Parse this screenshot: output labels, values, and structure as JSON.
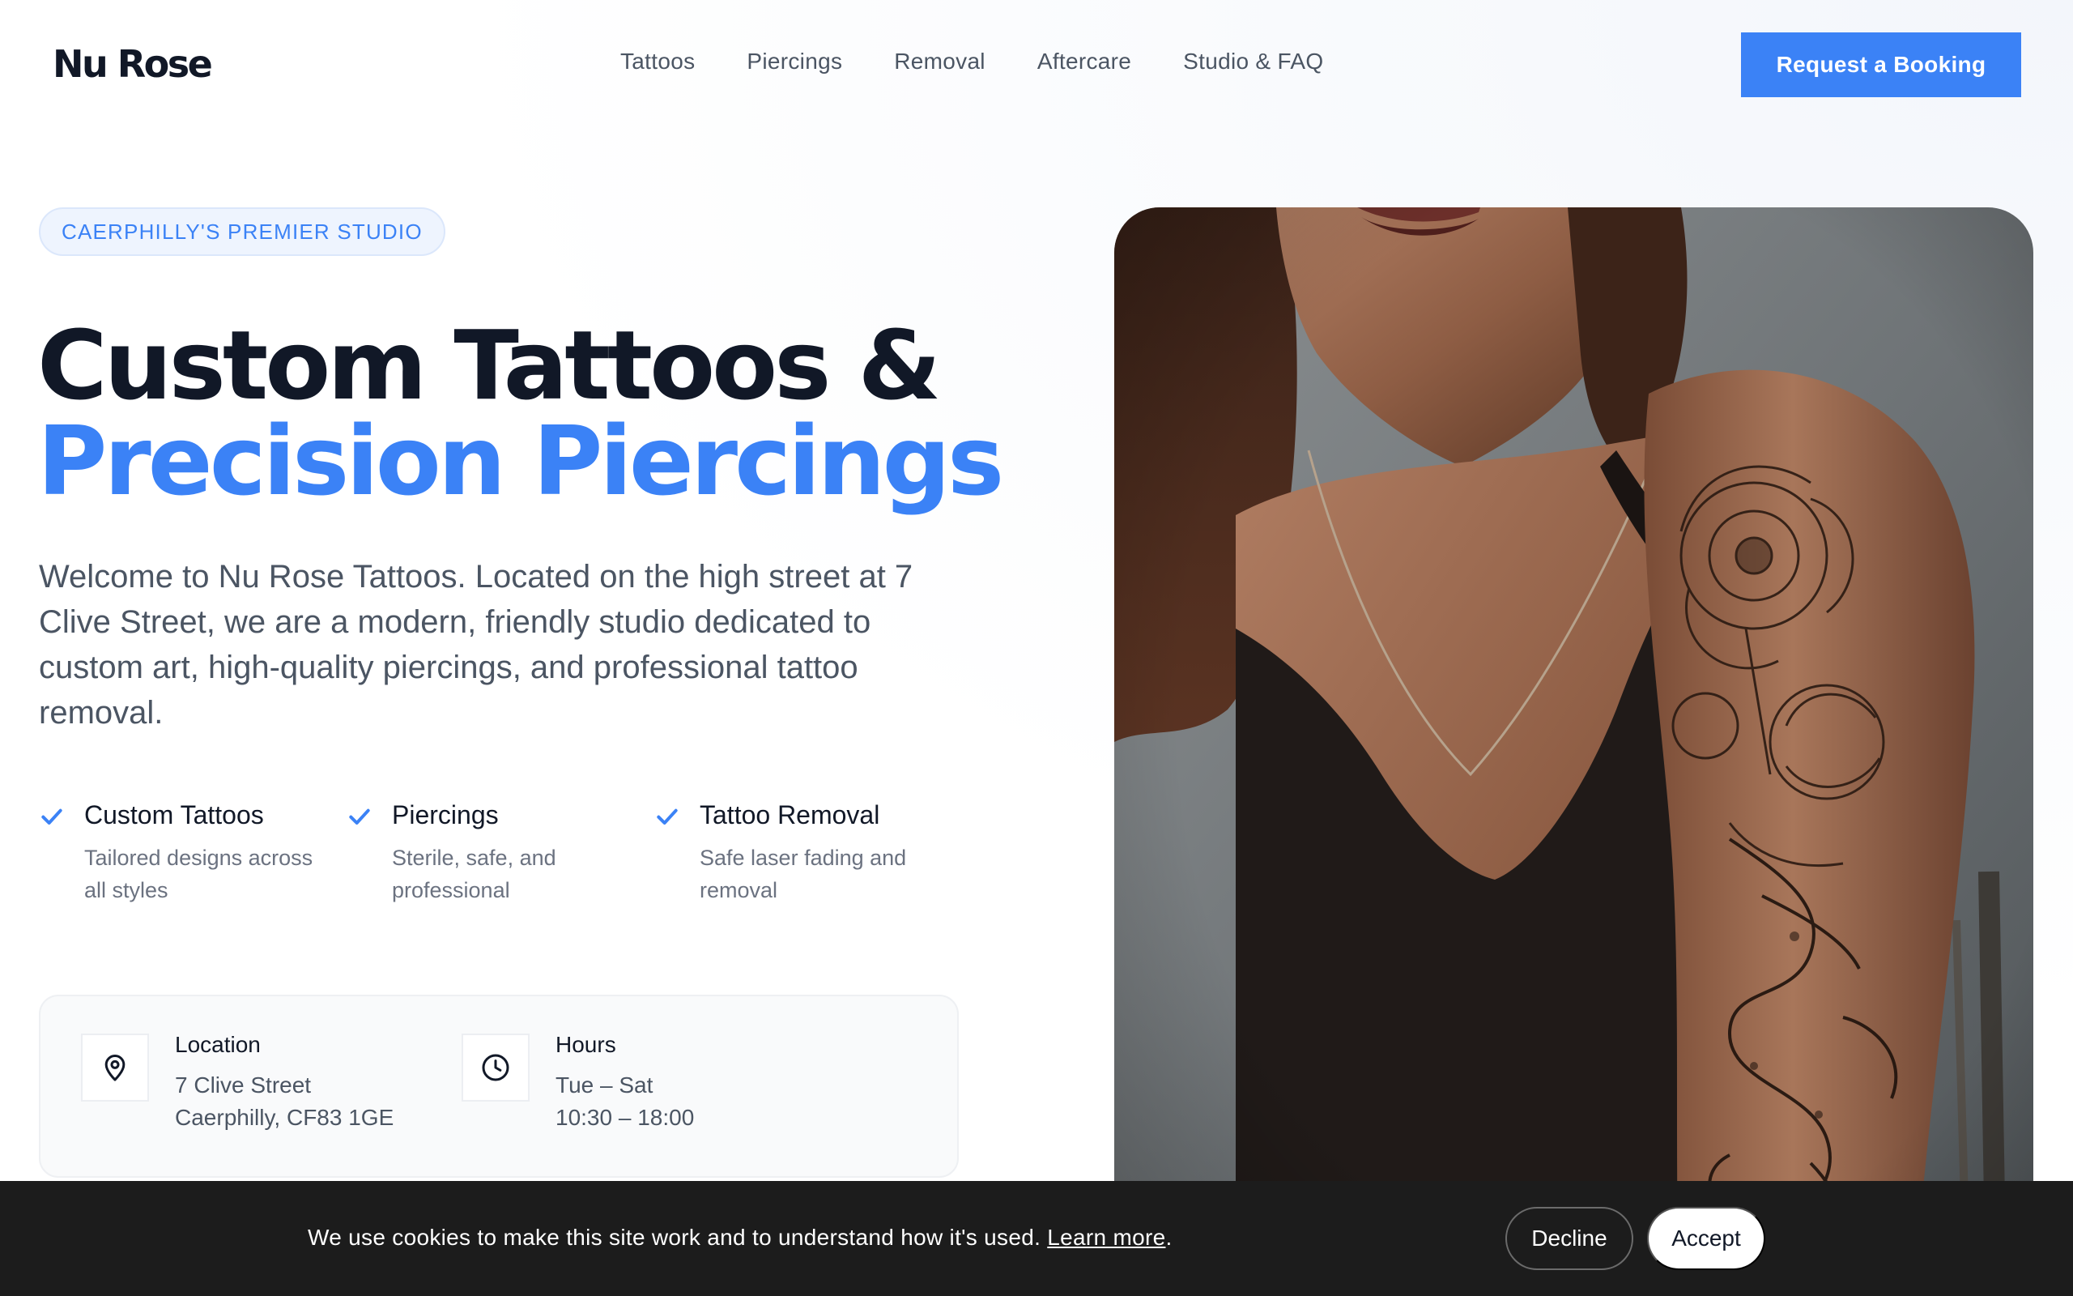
{
  "header": {
    "logo": "Nu Rose",
    "nav": [
      "Tattoos",
      "Piercings",
      "Removal",
      "Aftercare",
      "Studio & FAQ"
    ],
    "cta": "Request a Booking"
  },
  "hero": {
    "badge": "CAERPHILLY'S PREMIER STUDIO",
    "title_line1": "Custom Tattoos &",
    "title_line2": "Precision Piercings",
    "intro": "Welcome to Nu Rose Tattoos. Located on the high street at 7 Clive Street, we are a modern, friendly studio dedicated to custom art, high-quality piercings, and professional tattoo removal.",
    "features": [
      {
        "title": "Custom Tattoos",
        "desc": "Tailored designs across all styles"
      },
      {
        "title": "Piercings",
        "desc": "Sterile, safe, and professional"
      },
      {
        "title": "Tattoo Removal",
        "desc": "Safe laser fading and removal"
      }
    ],
    "info": {
      "location": {
        "label": "Location",
        "line1": "7 Clive Street",
        "line2": "Caerphilly, CF83 1GE"
      },
      "hours": {
        "label": "Hours",
        "line1": "Tue – Sat",
        "line2": "10:30 – 18:00"
      }
    },
    "image_alt": "Person with floral and dragon sleeve tattoo on shoulder"
  },
  "cookie": {
    "text": "We use cookies to make this site work and to understand how it's used.",
    "link": "Learn more",
    "period": ".",
    "decline": "Decline",
    "accept": "Accept"
  },
  "colors": {
    "accent": "#3b82f6",
    "dark": "#111827",
    "cookie_bg": "#1c1c1c"
  }
}
